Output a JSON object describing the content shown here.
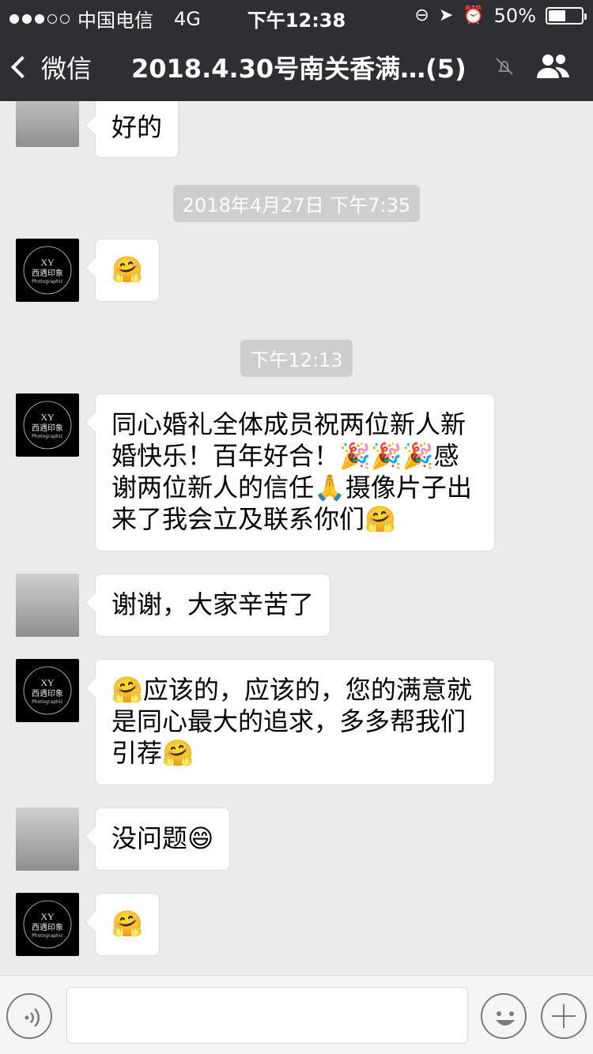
{
  "status_bar": {
    "carrier": "中国电信",
    "network": "4G",
    "time": "下午12:38",
    "battery": "50%"
  },
  "nav": {
    "back_label": "微信",
    "title": "2018.4.30号南关香满…(5)"
  },
  "messages": [
    {
      "text": "好的"
    },
    {
      "stamp": "2018年4月27日 下午7:35"
    },
    {
      "text": "🤗"
    },
    {
      "stamp": "下午12:13"
    },
    {
      "text": "同心婚礼全体成员祝两位新人新婚快乐！百年好合！🎉🎉🎉感谢两位新人的信任🙏摄像片子出来了我会立及联系你们🤗"
    },
    {
      "text": "谢谢，大家辛苦了"
    },
    {
      "text": "🤗应该的，应该的，您的满意就是同心最大的追求，多多帮我们引荐🤗"
    },
    {
      "text": "没问题😄"
    },
    {
      "text": "🤗"
    }
  ],
  "avatar_logo": {
    "line1": "XY",
    "line2": "西遇印象",
    "line3": "Photographic"
  },
  "colors": {
    "header_bg": "#2e2e33",
    "chat_bg": "#ebebeb",
    "bubble_bg": "#ffffff",
    "stamp_bg": "#cecece"
  }
}
